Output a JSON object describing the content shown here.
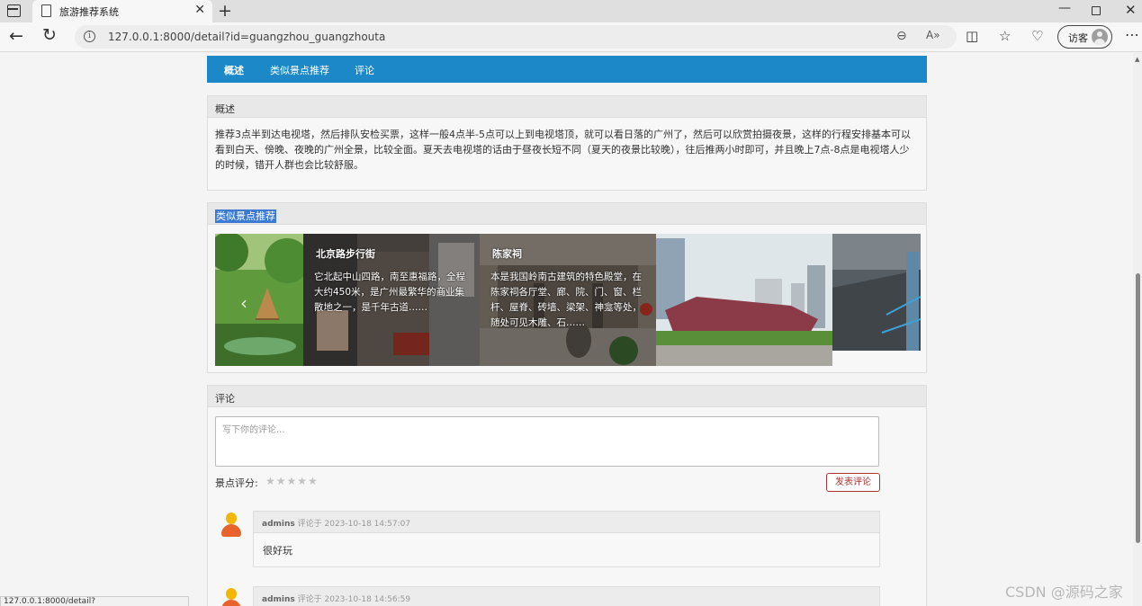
{
  "browser": {
    "tab_title": "旅游推荐系统",
    "tab_close": "✕",
    "new_tab": "+",
    "url": "127.0.0.1:8000/detail?id=guangzhou_guangzhouta",
    "guest_label": "访客",
    "status_url": "127.0.0.1:8000/detail?id=guangzhou_chenjiaci"
  },
  "nav": {
    "items": [
      "概述",
      "类似景点推荐",
      "评论"
    ],
    "active": "概述"
  },
  "overview": {
    "heading": "概述",
    "text": "推荐3点半到达电视塔，然后排队安检买票，这样一般4点半-5点可以上到电视塔顶，就可以看日落的广州了，然后可以欣赏拍摄夜景，这样的行程安排基本可以看到白天、傍晚、夜晚的广州全景，比较全面。夏天去电视塔的话由于昼夜长短不同（夏天的夜景比较晚），往后推两小时即可，并且晚上7点-8点是电视塔人少的时候，错开人群也会比较舒服。"
  },
  "similar": {
    "heading": "类似景点推荐",
    "slides": [
      {
        "title": "",
        "desc": "",
        "palette": "green"
      },
      {
        "title": "北京路步行街",
        "desc": "它北起中山四路，南至惠福路，全程大约450米，是广州最繁华的商业集散地之一，是千年古道……",
        "palette": "street"
      },
      {
        "title": "陈家祠",
        "desc": "本是我国岭南古建筑的特色殿堂，在陈家祠各厅堂、廊、院、门、窗、栏杆、屋脊、砖墙、梁架、神龛等处，随处可见木雕、石……",
        "palette": "temple"
      },
      {
        "title": "",
        "desc": "",
        "palette": "museum"
      },
      {
        "title": "",
        "desc": "",
        "palette": "city"
      }
    ]
  },
  "comments": {
    "heading": "评论",
    "placeholder": "写下你的评论...",
    "rating_label": "景点评分:",
    "stars": "★★★★★",
    "submit_label": "发表评论",
    "items": [
      {
        "user": "admins",
        "meta": "评论于 2023-10-18 14:57:07",
        "text": "很好玩"
      },
      {
        "user": "admins",
        "meta": "评论于 2023-10-18 14:56:59",
        "text": ""
      }
    ]
  },
  "watermark": "CSDN @源码之家"
}
